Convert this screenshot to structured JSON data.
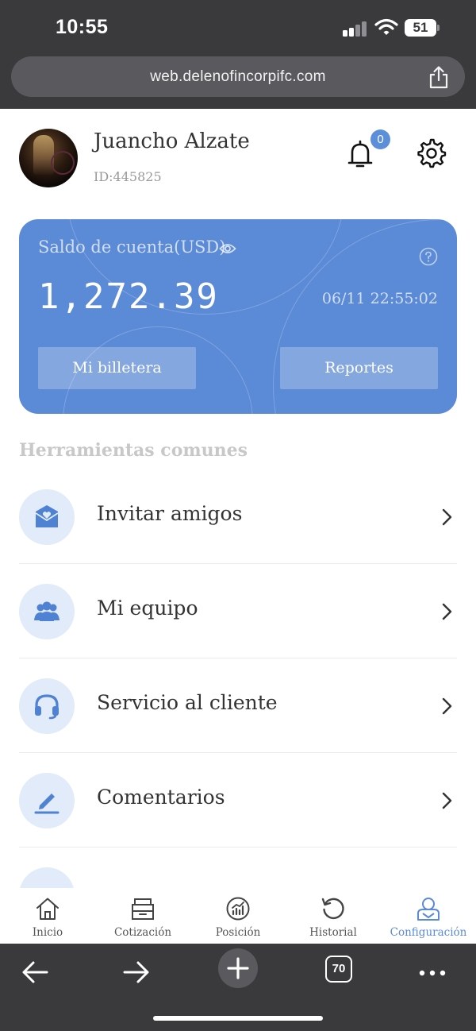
{
  "status_bar": {
    "time": "10:55",
    "battery": "51"
  },
  "browser": {
    "url": "web.delenofincorpifc.com",
    "tabs_count": "70"
  },
  "profile": {
    "name": "Juancho Alzate",
    "id_text": "ID:445825",
    "notification_count": "0"
  },
  "balance_card": {
    "label": "Saldo de cuenta(USD)",
    "amount": "1,272.39",
    "timestamp": "06/11 22:55:02",
    "wallet_button": "Mi billetera",
    "reports_button": "Reportes",
    "color": "#5b8ad6"
  },
  "tools": {
    "title": "Herramientas comunes",
    "items": [
      {
        "label": "Invitar amigos",
        "icon": "envelope-heart-icon"
      },
      {
        "label": "Mi equipo",
        "icon": "team-icon"
      },
      {
        "label": "Servicio al cliente",
        "icon": "headset-icon"
      },
      {
        "label": "Comentarios",
        "icon": "pencil-icon"
      }
    ]
  },
  "tabbar": {
    "accent": "#5b8ad6",
    "tabs": [
      {
        "label": "Inicio",
        "icon": "home-icon"
      },
      {
        "label": "Cotización",
        "icon": "archive-box-icon"
      },
      {
        "label": "Posición",
        "icon": "chart-circle-icon"
      },
      {
        "label": "Historial",
        "icon": "history-icon"
      },
      {
        "label": "Configuración",
        "icon": "user-icon",
        "active": true
      }
    ]
  }
}
